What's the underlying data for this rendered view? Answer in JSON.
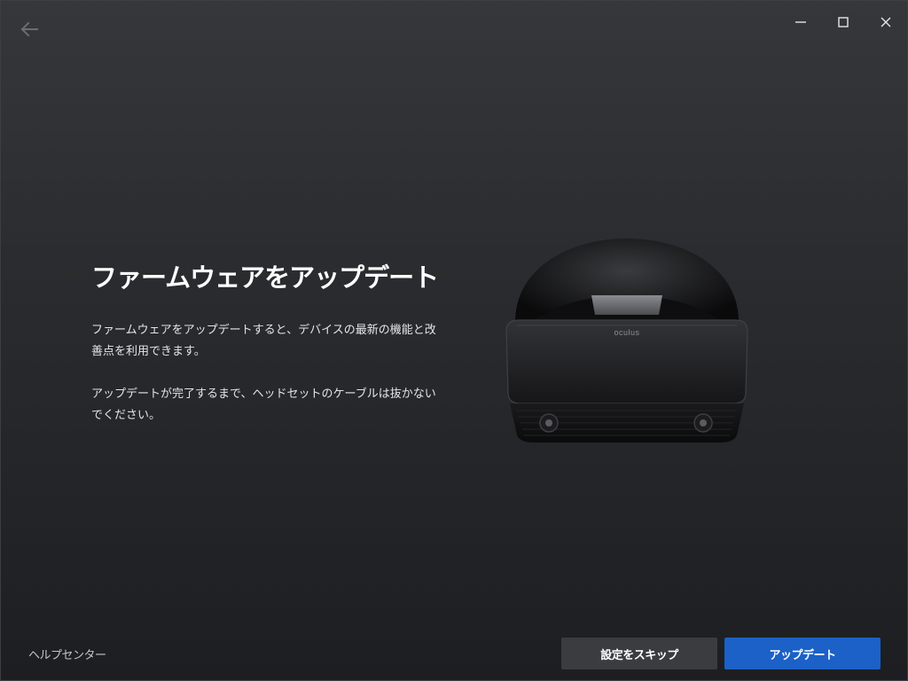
{
  "titlebar": {
    "icons": {
      "back": "arrow-left-icon",
      "minimize": "minimize-icon",
      "maximize": "maximize-icon",
      "close": "close-icon"
    }
  },
  "main": {
    "title": "ファームウェアをアップデート",
    "paragraph1": "ファームウェアをアップデートすると、デバイスの最新の機能と改善点を利用できます。",
    "paragraph2": "アップデートが完了するまで、ヘッドセットのケーブルは抜かないでください。",
    "device_brand": "oculus"
  },
  "footer": {
    "help_label": "ヘルプセンター",
    "skip_label": "設定をスキップ",
    "update_label": "アップデート"
  },
  "colors": {
    "primary_button": "#1b61c7",
    "secondary_button": "#3a3c40",
    "background_top": "#35373b",
    "background_bottom": "#1d1e21"
  }
}
